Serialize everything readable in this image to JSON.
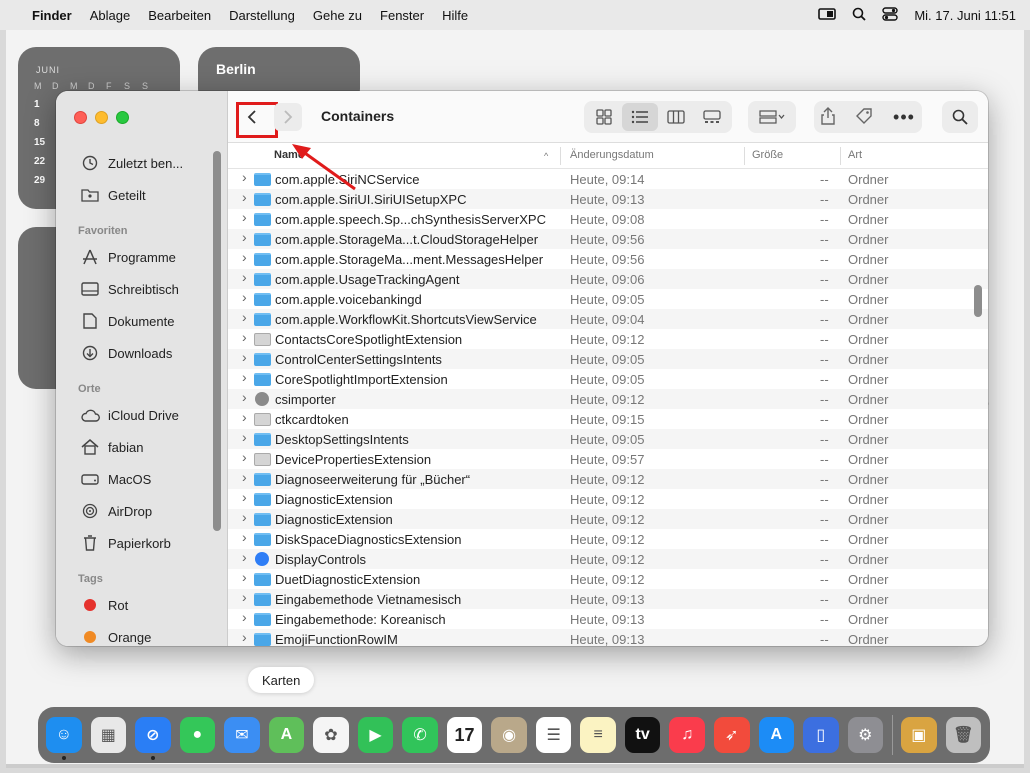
{
  "menubar": {
    "apple": "",
    "items": [
      "Finder",
      "Ablage",
      "Bearbeiten",
      "Darstellung",
      "Gehe zu",
      "Fenster",
      "Hilfe"
    ],
    "datetime": "Mi. 17. Juni  11:51"
  },
  "widgets": {
    "calendar_month": "JUNI",
    "weekdays": [
      "M",
      "D",
      "M",
      "D",
      "F",
      "S",
      "S"
    ],
    "day_numbers": [
      "1",
      "8",
      "15",
      "22",
      "29"
    ],
    "city": "Berlin"
  },
  "window": {
    "title": "Containers",
    "sidebar": {
      "recents": [
        {
          "label": "Zuletzt ben...",
          "icon": "clock-icon"
        },
        {
          "label": "Geteilt",
          "icon": "shared-folder-icon"
        }
      ],
      "favorites_heading": "Favoriten",
      "favorites": [
        {
          "label": "Programme",
          "icon": "applications-icon"
        },
        {
          "label": "Schreibtisch",
          "icon": "desktop-icon"
        },
        {
          "label": "Dokumente",
          "icon": "document-icon"
        },
        {
          "label": "Downloads",
          "icon": "download-icon"
        }
      ],
      "locations_heading": "Orte",
      "locations": [
        {
          "label": "iCloud Drive",
          "icon": "cloud-icon"
        },
        {
          "label": "fabian",
          "icon": "home-icon"
        },
        {
          "label": "MacOS",
          "icon": "disk-icon"
        },
        {
          "label": "AirDrop",
          "icon": "airdrop-icon"
        },
        {
          "label": "Papierkorb",
          "icon": "trash-icon"
        }
      ],
      "tags_heading": "Tags",
      "tags": [
        {
          "label": "Rot",
          "color": "#e5322d"
        },
        {
          "label": "Orange",
          "color": "#f08a24"
        }
      ]
    },
    "columns": {
      "name": "Name",
      "date": "Änderungsdatum",
      "size": "Größe",
      "kind": "Art"
    },
    "files": [
      {
        "name": "com.apple.SiriNCService",
        "date": "Heute, 09:14",
        "size": "--",
        "kind": "Ordner",
        "icon": "folder"
      },
      {
        "name": "com.apple.SiriUI.SiriUISetupXPC",
        "date": "Heute, 09:13",
        "size": "--",
        "kind": "Ordner",
        "icon": "folder"
      },
      {
        "name": "com.apple.speech.Sp...chSynthesisServerXPC",
        "date": "Heute, 09:08",
        "size": "--",
        "kind": "Ordner",
        "icon": "folder"
      },
      {
        "name": "com.apple.StorageMa...t.CloudStorageHelper",
        "date": "Heute, 09:56",
        "size": "--",
        "kind": "Ordner",
        "icon": "folder"
      },
      {
        "name": "com.apple.StorageMa...ment.MessagesHelper",
        "date": "Heute, 09:56",
        "size": "--",
        "kind": "Ordner",
        "icon": "folder"
      },
      {
        "name": "com.apple.UsageTrackingAgent",
        "date": "Heute, 09:06",
        "size": "--",
        "kind": "Ordner",
        "icon": "folder"
      },
      {
        "name": "com.apple.voicebankingd",
        "date": "Heute, 09:05",
        "size": "--",
        "kind": "Ordner",
        "icon": "folder"
      },
      {
        "name": "com.apple.WorkflowKit.ShortcutsViewService",
        "date": "Heute, 09:04",
        "size": "--",
        "kind": "Ordner",
        "icon": "folder"
      },
      {
        "name": "ContactsCoreSpotlightExtension",
        "date": "Heute, 09:12",
        "size": "--",
        "kind": "Ordner",
        "icon": "gray"
      },
      {
        "name": "ControlCenterSettingsIntents",
        "date": "Heute, 09:05",
        "size": "--",
        "kind": "Ordner",
        "icon": "folder"
      },
      {
        "name": "CoreSpotlightImportExtension",
        "date": "Heute, 09:05",
        "size": "--",
        "kind": "Ordner",
        "icon": "folder"
      },
      {
        "name": "csimporter",
        "date": "Heute, 09:12",
        "size": "--",
        "kind": "Ordner",
        "icon": "gear"
      },
      {
        "name": "ctkcardtoken",
        "date": "Heute, 09:15",
        "size": "--",
        "kind": "Ordner",
        "icon": "gray"
      },
      {
        "name": "DesktopSettingsIntents",
        "date": "Heute, 09:05",
        "size": "--",
        "kind": "Ordner",
        "icon": "folder"
      },
      {
        "name": "DevicePropertiesExtension",
        "date": "Heute, 09:57",
        "size": "--",
        "kind": "Ordner",
        "icon": "gray"
      },
      {
        "name": "Diagnoseerweiterung für „Bücher“",
        "date": "Heute, 09:12",
        "size": "--",
        "kind": "Ordner",
        "icon": "folder"
      },
      {
        "name": "DiagnosticExtension",
        "date": "Heute, 09:12",
        "size": "--",
        "kind": "Ordner",
        "icon": "folder"
      },
      {
        "name": "DiagnosticExtension",
        "date": "Heute, 09:12",
        "size": "--",
        "kind": "Ordner",
        "icon": "folder"
      },
      {
        "name": "DiskSpaceDiagnosticsExtension",
        "date": "Heute, 09:12",
        "size": "--",
        "kind": "Ordner",
        "icon": "folder"
      },
      {
        "name": "DisplayControls",
        "date": "Heute, 09:12",
        "size": "--",
        "kind": "Ordner",
        "icon": "blueapp"
      },
      {
        "name": "DuetDiagnosticExtension",
        "date": "Heute, 09:12",
        "size": "--",
        "kind": "Ordner",
        "icon": "folder"
      },
      {
        "name": "Eingabemethode Vietnamesisch",
        "date": "Heute, 09:13",
        "size": "--",
        "kind": "Ordner",
        "icon": "folder"
      },
      {
        "name": "Eingabemethode: Koreanisch",
        "date": "Heute, 09:13",
        "size": "--",
        "kind": "Ordner",
        "icon": "folder"
      },
      {
        "name": "EmojiFunctionRowIM",
        "date": "Heute, 09:13",
        "size": "--",
        "kind": "Ordner",
        "icon": "folder"
      }
    ]
  },
  "tooltip": "Karten",
  "dock": [
    {
      "name": "finder",
      "color": "#1e8ef0",
      "glyph": "☺",
      "running": true
    },
    {
      "name": "launchpad",
      "color": "#e8e8e8",
      "glyph": "▦",
      "running": false
    },
    {
      "name": "safari",
      "color": "#2a7ef5",
      "glyph": "⊘",
      "running": true
    },
    {
      "name": "messages",
      "color": "#34c759",
      "glyph": "●",
      "running": false
    },
    {
      "name": "mail",
      "color": "#3b8ef3",
      "glyph": "✉",
      "running": false
    },
    {
      "name": "maps",
      "color": "#5fbf5a",
      "glyph": "A",
      "running": false
    },
    {
      "name": "photos",
      "color": "#f5f5f5",
      "glyph": "✿",
      "running": false
    },
    {
      "name": "facetime",
      "color": "#32c158",
      "glyph": "▶",
      "running": false
    },
    {
      "name": "phone",
      "color": "#31c45a",
      "glyph": "✆",
      "running": false
    },
    {
      "name": "calendar",
      "color": "#ffffff",
      "glyph": "17",
      "running": false
    },
    {
      "name": "contacts",
      "color": "#b9a88a",
      "glyph": "◉",
      "running": false
    },
    {
      "name": "reminders",
      "color": "#ffffff",
      "glyph": "☰",
      "running": false
    },
    {
      "name": "notes",
      "color": "#fbf3c2",
      "glyph": "≡",
      "running": false
    },
    {
      "name": "tv",
      "color": "#111111",
      "glyph": "tv",
      "running": false
    },
    {
      "name": "music",
      "color": "#fa3c4c",
      "glyph": "♫",
      "running": false
    },
    {
      "name": "rocket",
      "color": "#f24b3c",
      "glyph": "➶",
      "running": false
    },
    {
      "name": "app-store",
      "color": "#1c8cf6",
      "glyph": "A",
      "running": false
    },
    {
      "name": "iphone-mirroring",
      "color": "#3c6fe0",
      "glyph": "▯",
      "running": false
    },
    {
      "name": "system-settings",
      "color": "#8e8e93",
      "glyph": "⚙",
      "running": false
    },
    {
      "name": "archive",
      "color": "#d9a441",
      "glyph": "▣",
      "running": false
    },
    {
      "name": "trash",
      "color": "#bfbfbf",
      "glyph": "🗑",
      "running": false
    }
  ]
}
